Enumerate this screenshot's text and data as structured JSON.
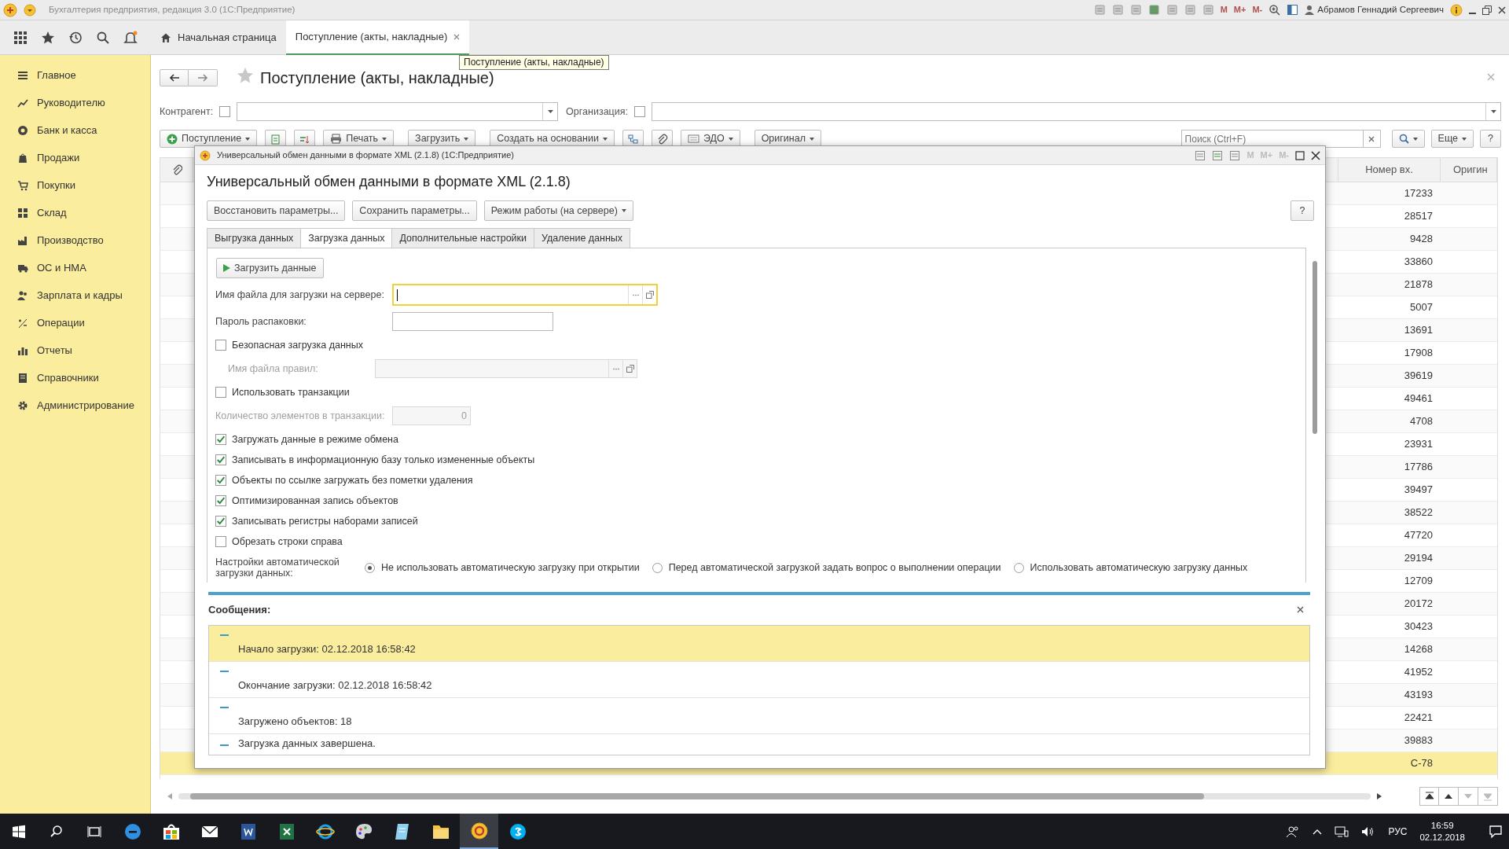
{
  "window": {
    "title": "Бухгалтерия предприятия, редакция 3.0  (1С:Предприятие)",
    "memory_buttons": [
      "M",
      "M+",
      "M-"
    ],
    "user": "Абрамов Геннадий Сергеевич"
  },
  "tabs": [
    {
      "label": "Начальная страница",
      "selected": false,
      "closable": false
    },
    {
      "label": "Поступление (акты, накладные)",
      "selected": true,
      "closable": true
    }
  ],
  "tooltip": "Поступление (акты, накладные)",
  "sidebar": {
    "items": [
      {
        "label": "Главное"
      },
      {
        "label": "Руководителю"
      },
      {
        "label": "Банк и касса"
      },
      {
        "label": "Продажи"
      },
      {
        "label": "Покупки"
      },
      {
        "label": "Склад"
      },
      {
        "label": "Производство"
      },
      {
        "label": "ОС и НМА"
      },
      {
        "label": "Зарплата и кадры"
      },
      {
        "label": "Операции"
      },
      {
        "label": "Отчеты"
      },
      {
        "label": "Справочники"
      },
      {
        "label": "Администрирование"
      }
    ]
  },
  "document": {
    "title": "Поступление (акты, накладные)",
    "filters": [
      {
        "label": "Контрагент:",
        "checked": false
      },
      {
        "label": "Организация:",
        "checked": false
      }
    ],
    "toolbar": [
      {
        "kind": "button",
        "label": "Поступление",
        "dropdown": true
      },
      {
        "kind": "icon"
      },
      {
        "kind": "icon"
      },
      {
        "kind": "button",
        "label": "Печать",
        "dropdown": true
      },
      {
        "kind": "button",
        "label": "Загрузить",
        "dropdown": true
      },
      {
        "kind": "button",
        "label": "Создать на основании",
        "dropdown": true
      },
      {
        "kind": "icon"
      },
      {
        "kind": "icon"
      },
      {
        "kind": "button",
        "label": "ЭДО",
        "dropdown": true
      },
      {
        "kind": "button",
        "label": "Оригинал",
        "dropdown": true
      }
    ],
    "search": {
      "placeholder": "Поиск (Ctrl+F)"
    },
    "more": "Еще",
    "help": "?"
  },
  "table": {
    "columns": [
      "Номер вх.",
      "Оригин"
    ],
    "rows": [
      {
        "number": "17233",
        "selected": false
      },
      {
        "number": "28517",
        "selected": false
      },
      {
        "number": "9428",
        "selected": false
      },
      {
        "number": "33860",
        "selected": false
      },
      {
        "number": "21878",
        "selected": false
      },
      {
        "number": "5007",
        "selected": false
      },
      {
        "number": "13691",
        "selected": false
      },
      {
        "number": "17908",
        "selected": false
      },
      {
        "number": "39619",
        "selected": false
      },
      {
        "number": "49461",
        "selected": false
      },
      {
        "number": "4708",
        "selected": false
      },
      {
        "number": "23931",
        "selected": false
      },
      {
        "number": "17786",
        "selected": false
      },
      {
        "number": "39497",
        "selected": false
      },
      {
        "number": "38522",
        "selected": false
      },
      {
        "number": "47720",
        "selected": false
      },
      {
        "number": "29194",
        "selected": false
      },
      {
        "number": "12709",
        "selected": false
      },
      {
        "number": "20172",
        "selected": false
      },
      {
        "number": "30423",
        "selected": false
      },
      {
        "number": "14268",
        "selected": false
      },
      {
        "number": "41952",
        "selected": false
      },
      {
        "number": "43193",
        "selected": false
      },
      {
        "number": "22421",
        "selected": false
      },
      {
        "number": "39883",
        "selected": false
      },
      {
        "number": "С-78",
        "selected": true
      }
    ]
  },
  "dialog": {
    "title": "Универсальный обмен данными в формате XML (2.1.8)  (1С:Предприятие)",
    "memory_buttons": [
      "M",
      "M+",
      "M-"
    ],
    "heading": "Универсальный обмен данными в формате XML (2.1.8)",
    "buttons": [
      {
        "label": "Восстановить параметры...",
        "dropdown": false
      },
      {
        "label": "Сохранить параметры...",
        "dropdown": false
      },
      {
        "label": "Режим работы (на сервере)",
        "dropdown": true
      }
    ],
    "help": "?",
    "tabs": [
      {
        "label": "Выгрузка данных",
        "selected": false
      },
      {
        "label": "Загрузка данных",
        "selected": true
      },
      {
        "label": "Дополнительные настройки",
        "selected": false
      },
      {
        "label": "Удаление данных",
        "selected": false
      }
    ],
    "run_button": "Загрузить данные",
    "form": [
      {
        "kind": "field",
        "label": "Имя файла для загрузки на сервере:",
        "focused": true,
        "disabled": false,
        "choice_buttons": true
      },
      {
        "kind": "field",
        "label": "Пароль распаковки:",
        "focused": false,
        "disabled": false,
        "choice_buttons": false
      },
      {
        "kind": "checkbox",
        "label": "Безопасная загрузка данных",
        "checked": false,
        "children": [
          {
            "kind": "field",
            "label": "Имя файла правил:",
            "focused": false,
            "disabled": true,
            "choice_buttons": true
          }
        ]
      },
      {
        "kind": "checkbox",
        "label": "Использовать транзакции",
        "checked": false
      },
      {
        "kind": "field",
        "label": "Количество элементов в транзакции:",
        "value": "0",
        "focused": false,
        "disabled": true,
        "choice_buttons": false
      },
      {
        "kind": "checkbox",
        "label": "Загружать данные в режиме обмена",
        "checked": true
      },
      {
        "kind": "checkbox",
        "label": "Записывать в информационную базу только измененные объекты",
        "checked": true
      },
      {
        "kind": "checkbox",
        "label": "Объекты по ссылке загружать без пометки удаления",
        "checked": true
      },
      {
        "kind": "checkbox",
        "label": "Оптимизированная запись объектов",
        "checked": true
      },
      {
        "kind": "checkbox",
        "label": "Записывать регистры наборами записей",
        "checked": true
      },
      {
        "kind": "checkbox",
        "label": "Обрезать строки справа",
        "checked": false
      },
      {
        "kind": "radio",
        "label": "Настройки автоматической загрузки данных:",
        "options": [
          {
            "label": "Не использовать автоматическую загрузку при открытии",
            "selected": true
          },
          {
            "label": "Перед автоматической загрузкой задать вопрос о выполнении операции",
            "selected": false
          },
          {
            "label": "Использовать автоматическую загрузку данных",
            "selected": false
          }
        ]
      }
    ],
    "messages_title": "Сообщения:",
    "messages": [
      {
        "text": "Начало загрузки: 02.12.2018 16:58:42",
        "selected": true
      },
      {
        "text": "Окончание загрузки: 02.12.2018 16:58:42",
        "selected": false
      },
      {
        "text": "Загружено объектов: 18",
        "selected": false
      },
      {
        "text": "Загрузка данных завершена.",
        "selected": false
      }
    ]
  },
  "taskbar": {
    "apps": [
      {
        "selected": false
      },
      {
        "selected": false
      },
      {
        "selected": false
      },
      {
        "selected": false
      },
      {
        "selected": false
      },
      {
        "selected": false
      },
      {
        "selected": false
      },
      {
        "selected": false
      },
      {
        "selected": false
      },
      {
        "selected": true
      },
      {
        "selected": false
      }
    ],
    "language": "РУС",
    "time": "16:59",
    "date": "02.12.2018"
  }
}
